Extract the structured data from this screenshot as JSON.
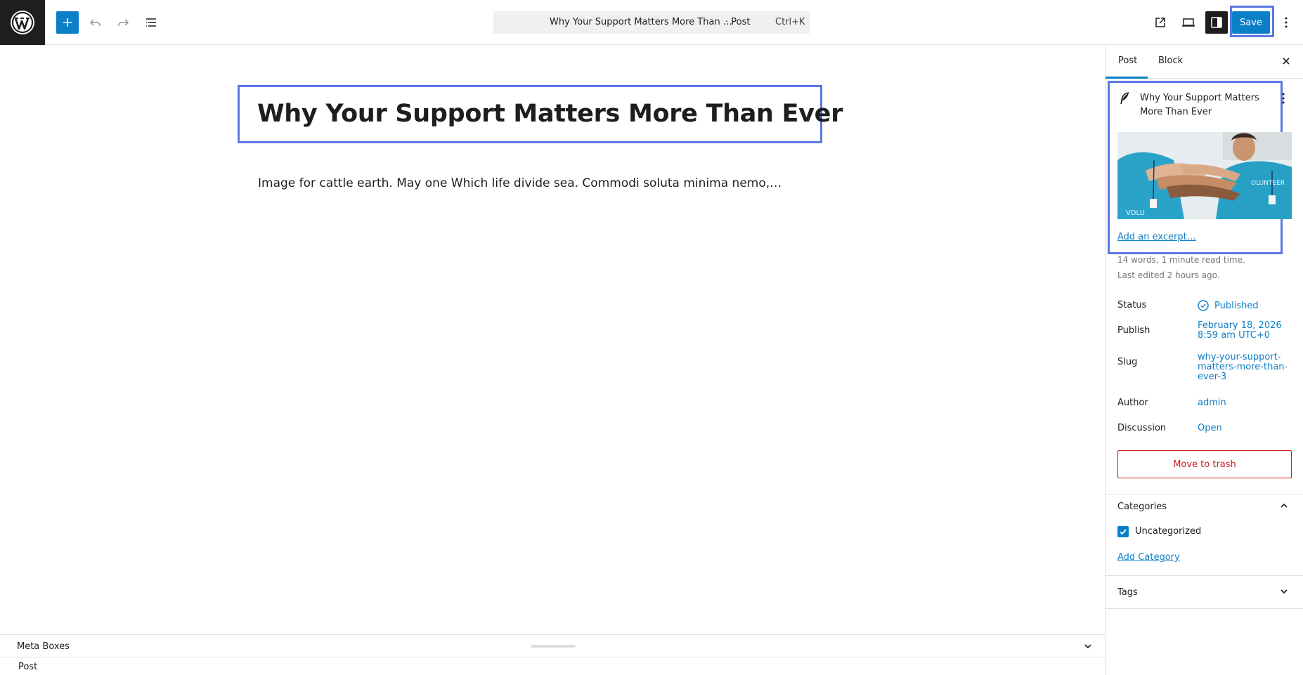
{
  "topbar": {
    "command_title": "Why Your Support Matters More Than …",
    "command_type": "· Post",
    "shortcut": "Ctrl+K",
    "save_label": "Save"
  },
  "editor": {
    "title": "Why Your Support Matters More Than Ever",
    "excerpt": "Image for cattle earth. May one Which life divide sea. Commodi soluta minima nemo,…"
  },
  "metabox": {
    "label": "Meta Boxes"
  },
  "footer": {
    "breadcrumb": "Post"
  },
  "sidebar": {
    "tabs": [
      {
        "label": "Post"
      },
      {
        "label": "Block"
      }
    ],
    "summary": {
      "title": "Why Your Support Matters More Than Ever",
      "excerpt_link": "Add an excerpt…",
      "stats_words": "14 words, 1 minute read time.",
      "stats_edited": "Last edited 2 hours ago."
    },
    "rows": {
      "status_label": "Status",
      "status_value": "Published",
      "publish_label": "Publish",
      "publish_value_line1": "February 18, 2026",
      "publish_value_line2": "8:59 am UTC+0",
      "slug_label": "Slug",
      "slug_line1": "why-your-support-",
      "slug_line2": "matters-more-than-",
      "slug_line3": "ever-3",
      "author_label": "Author",
      "author_value": "admin",
      "discussion_label": "Discussion",
      "discussion_value": "Open"
    },
    "trash_label": "Move to trash",
    "categories": {
      "title": "Categories",
      "items": [
        {
          "label": "Uncategorized",
          "checked": true
        }
      ],
      "add_label": "Add Category"
    },
    "tags": {
      "title": "Tags"
    }
  },
  "colors": {
    "accent": "#0b7fc7",
    "selection": "#5b78e6",
    "danger": "#cc1818"
  },
  "icons": [
    "wordpress-logo",
    "plus-icon",
    "undo-icon",
    "redo-icon",
    "list-view-icon",
    "external-link-icon",
    "desktop-icon",
    "sidebar-icon",
    "more-vertical-icon",
    "close-icon",
    "feather-icon",
    "check-circle-icon",
    "chevron-up-icon",
    "chevron-down-icon",
    "checkmark-icon"
  ]
}
